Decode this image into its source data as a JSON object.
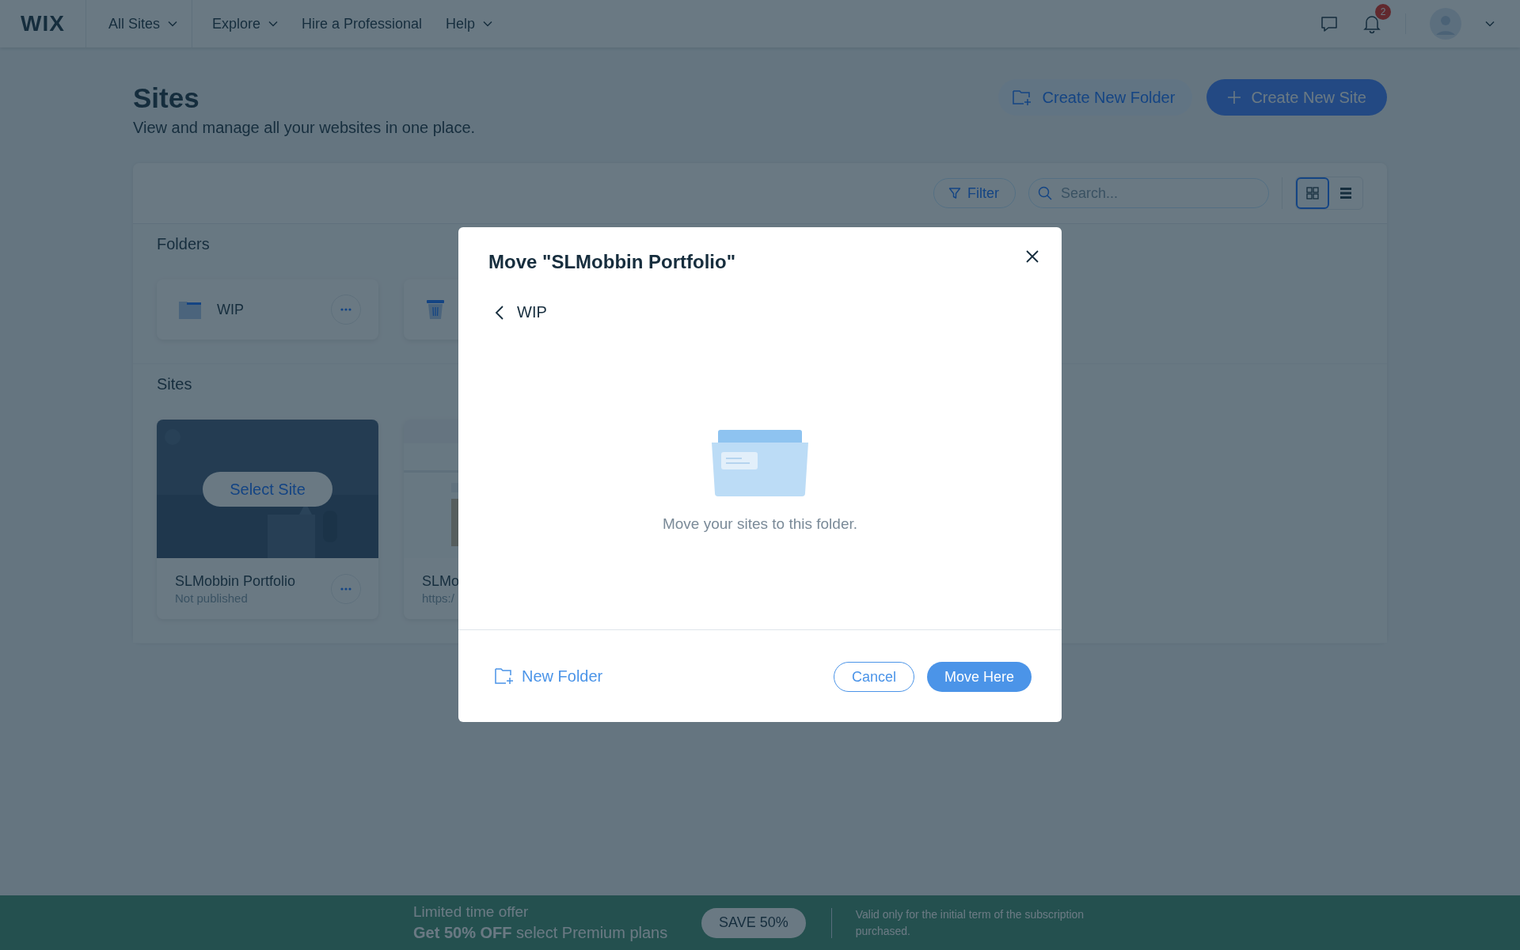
{
  "top_nav": {
    "logo": "WIX",
    "items": [
      {
        "label": "All Sites",
        "dropdown": true
      },
      {
        "label": "Explore",
        "dropdown": true
      },
      {
        "label": "Hire a Professional",
        "dropdown": false
      },
      {
        "label": "Help",
        "dropdown": true
      }
    ],
    "notifications_count": "2"
  },
  "header": {
    "title": "Sites",
    "subtitle": "View and manage all your websites in one place.",
    "buttons": [
      {
        "label": "Create New Folder",
        "kind": "secondary"
      },
      {
        "label": "Create New Site",
        "kind": "primary"
      }
    ]
  },
  "toolbar": {
    "filter": "Filter",
    "search": {
      "placeholder": "Search..."
    },
    "views": [
      {
        "kind": "grid",
        "selected": true
      },
      {
        "kind": "list",
        "selected": false
      }
    ]
  },
  "folders": {
    "heading": "Folders",
    "items": [
      {
        "kind": "folder",
        "name": "WIP"
      },
      {
        "kind": "trash"
      }
    ]
  },
  "sites": {
    "heading": "Sites",
    "items": [
      {
        "name": "SLMobbin Portfolio",
        "status": "Not published",
        "hover_action": "Select Site"
      },
      {
        "name": "SLMo",
        "status": "https:/"
      }
    ]
  },
  "dialog": {
    "title": "Move \"SLMobbin Portfolio\"",
    "folder": "WIP",
    "empty_message": "Move your sites to this folder.",
    "new_folder": "New Folder",
    "buttons": [
      {
        "label": "Cancel",
        "kind": "secondary"
      },
      {
        "label": "Move Here",
        "kind": "primary"
      }
    ]
  },
  "banner": {
    "eyebrow": "Limited time offer",
    "offer": "**Get 50% OFF** select Premium plans",
    "button": "SAVE 50%",
    "note": "Valid only for the initial term of the subscription purchased."
  }
}
